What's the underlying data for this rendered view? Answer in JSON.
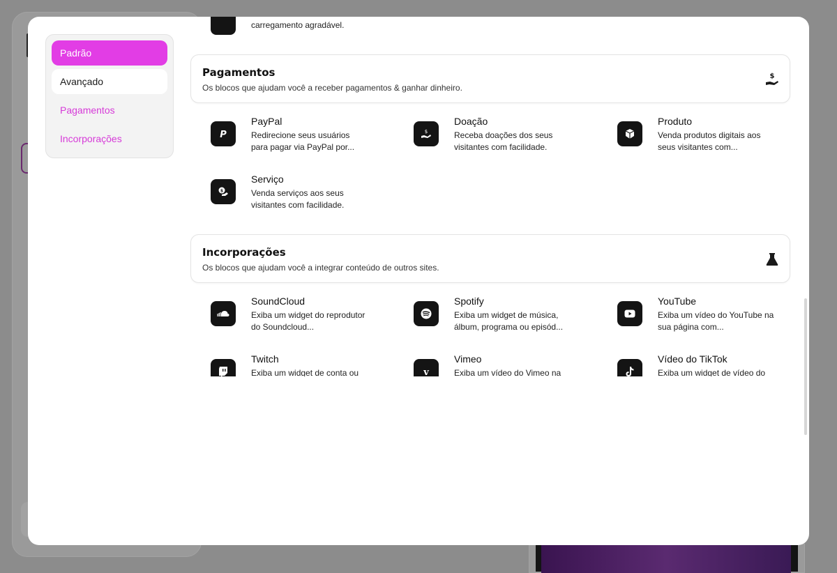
{
  "sidebar": {
    "items": [
      {
        "label": "Padrão",
        "state": "active"
      },
      {
        "label": "Avançado",
        "state": "default"
      },
      {
        "label": "Pagamentos",
        "state": "link"
      },
      {
        "label": "Incorporações",
        "state": "link"
      }
    ]
  },
  "content": {
    "previous_block_fragment": "carregamento agradável.",
    "sections": [
      {
        "title": "Pagamentos",
        "description": "Os blocos que ajudam você a receber pagamentos & ganhar dinheiro.",
        "icon": "hand-money-icon",
        "blocks": [
          {
            "title": "PayPal",
            "description": "Redirecione seus usuários para pagar via PayPal por...",
            "icon": "paypal-icon"
          },
          {
            "title": "Doação",
            "description": "Receba doações dos seus visitantes com facilidade.",
            "icon": "donation-icon"
          },
          {
            "title": "Produto",
            "description": "Venda produtos digitais aos seus visitantes com...",
            "icon": "box-icon"
          },
          {
            "title": "Serviço",
            "description": "Venda serviços aos seus visitantes com facilidade.",
            "icon": "service-icon"
          }
        ]
      },
      {
        "title": "Incorporações",
        "description": "Os blocos que ajudam você a integrar conteúdo de outros sites.",
        "icon": "flask-icon",
        "blocks": [
          {
            "title": "SoundCloud",
            "description": "Exiba um widget do reprodutor do Soundcloud...",
            "icon": "soundcloud-icon"
          },
          {
            "title": "Spotify",
            "description": "Exiba um widget de música, álbum, programa ou episód...",
            "icon": "spotify-icon"
          },
          {
            "title": "YouTube",
            "description": "Exiba um vídeo do YouTube na sua página com...",
            "icon": "youtube-icon"
          },
          {
            "title": "Twitch",
            "description": "Exiba um widget de conta ou",
            "icon": "twitch-icon"
          },
          {
            "title": "Vimeo",
            "description": "Exiba um vídeo do Vimeo na",
            "icon": "vimeo-icon"
          },
          {
            "title": "Vídeo do TikTok",
            "description": "Exiba um widget de vídeo do",
            "icon": "tiktok-icon"
          }
        ]
      }
    ]
  },
  "colors": {
    "accent": "#e23de5",
    "accent_text": "#d63ad8",
    "icon_bg": "#141414",
    "overlay": "#8c8c8c"
  }
}
